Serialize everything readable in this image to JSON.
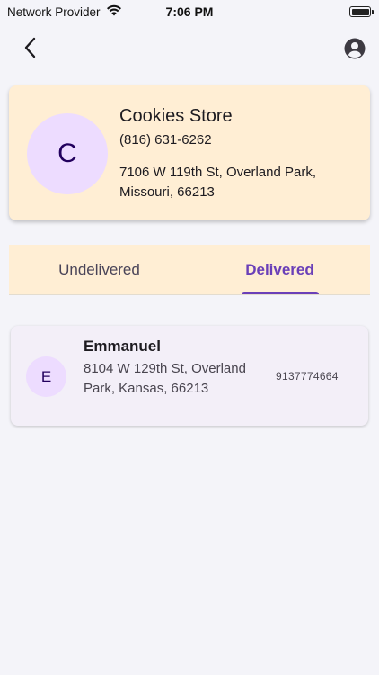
{
  "status_bar": {
    "carrier": "Network Provider",
    "time": "7:06 PM"
  },
  "store": {
    "initial": "C",
    "name": "Cookies Store",
    "phone": "(816) 631-6262",
    "address": "7106 W 119th St, Overland Park, Missouri, 66213"
  },
  "tabs": [
    {
      "label": "Undelivered",
      "selected": false
    },
    {
      "label": "Delivered",
      "selected": true
    }
  ],
  "orders": [
    {
      "initial": "E",
      "name": "Emmanuel",
      "address": "8104 W 129th St, Overland Park, Kansas, 66213",
      "phone": "9137774664"
    }
  ],
  "colors": {
    "accent": "#6a3fb8",
    "card_background": "#ffeed4",
    "avatar_background": "#eddcff",
    "page_background": "#f4f4f9"
  },
  "icons": {
    "back": "chevron-left-icon",
    "profile": "account-circle-icon",
    "wifi": "wifi-icon",
    "battery": "battery-icon"
  }
}
